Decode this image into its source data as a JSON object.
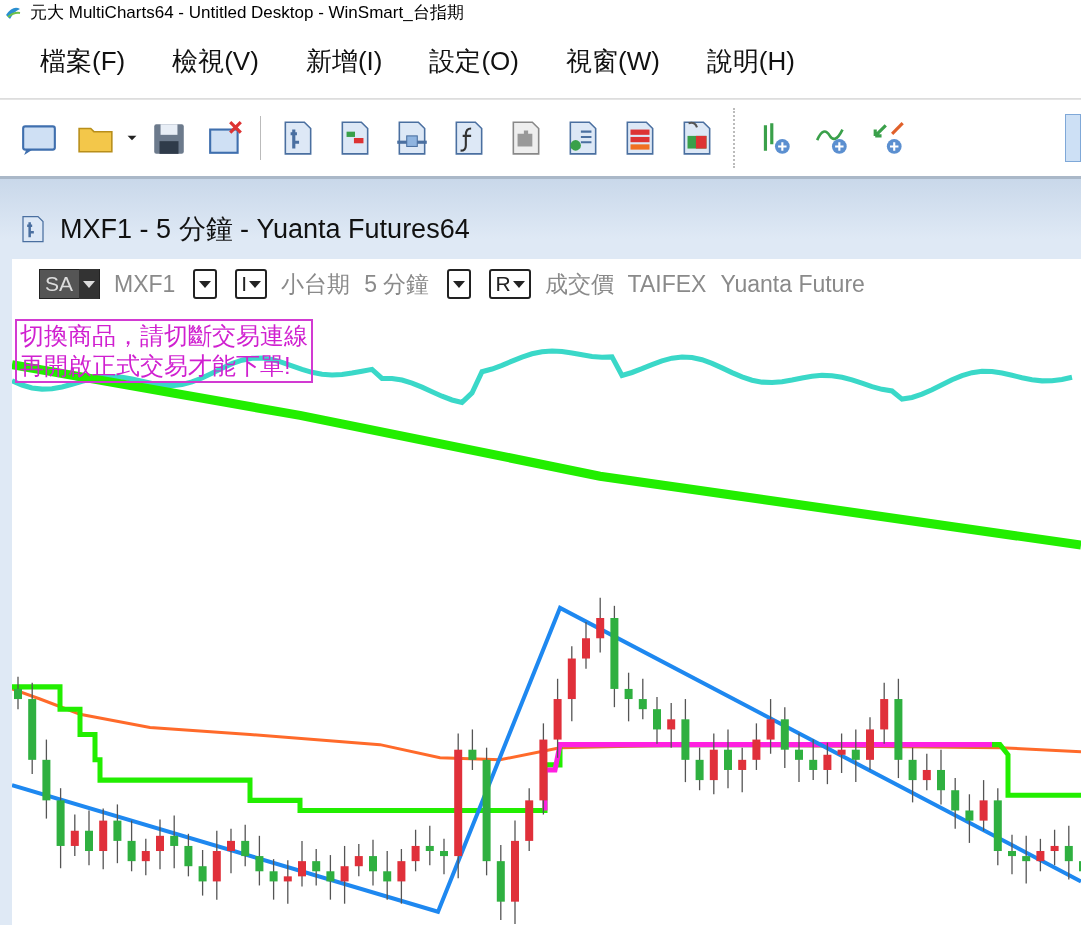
{
  "window": {
    "title": "元大 MultiCharts64 - Untitled Desktop - WinSmart_台指期"
  },
  "menu": [
    "檔案(F)",
    "檢視(V)",
    "新增(I)",
    "設定(O)",
    "視窗(W)",
    "說明(H)"
  ],
  "chart_window": {
    "title": "MXF1 - 5 分鐘 - Yuanta Futures64",
    "header": [
      {
        "kind": "button",
        "label": "SA"
      },
      {
        "kind": "text",
        "label": "MXF1"
      },
      {
        "kind": "dropdown"
      },
      {
        "kind": "dropdown",
        "label": "I"
      },
      {
        "kind": "text",
        "label": "小台期"
      },
      {
        "kind": "text",
        "label": "5 分鐘"
      },
      {
        "kind": "dropdown"
      },
      {
        "kind": "dropdown",
        "label": "R"
      },
      {
        "kind": "text",
        "label": "成交價"
      },
      {
        "kind": "text",
        "label": "TAIFEX"
      },
      {
        "kind": "text",
        "label": "Yuanta Future"
      }
    ],
    "message": [
      "切換商品，請切斷交易連線",
      "再開啟正式交易才能下單!"
    ]
  }
}
